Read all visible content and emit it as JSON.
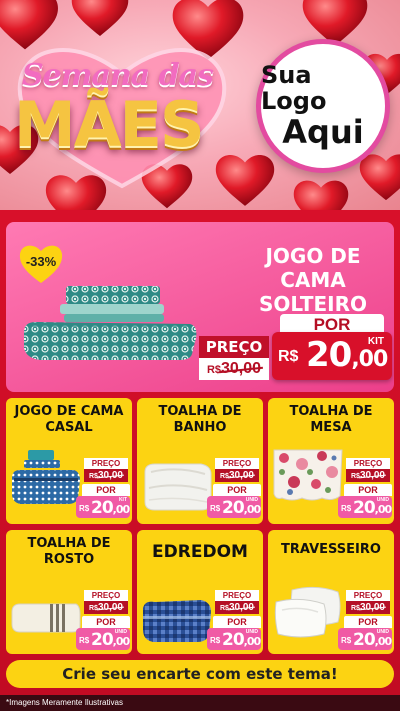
{
  "header": {
    "logo_script": "Semana das",
    "logo_big": "MÃES",
    "brand_line1": "Sua Logo",
    "brand_line2": "Aqui"
  },
  "featured": {
    "discount": "-33%",
    "title": "JOGO DE CAMA SOLTEIRO",
    "preco_label": "PREÇO",
    "old_currency": "R$",
    "old_value": "30,00",
    "por_label": "POR",
    "kit_label": "KIT",
    "currency": "R$",
    "price_int": "20",
    "price_cents": ",00"
  },
  "cards": [
    {
      "title": "JOGO DE CAMA CASAL",
      "preco_label": "PREÇO",
      "old_currency": "R$",
      "old_value": "30,00",
      "por_label": "POR",
      "unit": "KIT",
      "currency": "R$",
      "price_int": "20",
      "price_cents": ",00"
    },
    {
      "title": "TOALHA DE BANHO",
      "preco_label": "PREÇO",
      "old_currency": "R$",
      "old_value": "30,00",
      "por_label": "POR",
      "unit": "UNID",
      "currency": "R$",
      "price_int": "20",
      "price_cents": ",00"
    },
    {
      "title": "TOALHA DE MESA",
      "preco_label": "PREÇO",
      "old_currency": "R$",
      "old_value": "30,00",
      "por_label": "POR",
      "unit": "UNID",
      "currency": "R$",
      "price_int": "20",
      "price_cents": ",00"
    },
    {
      "title": "TOALHA DE ROSTO",
      "preco_label": "PREÇO",
      "old_currency": "R$",
      "old_value": "30,00",
      "por_label": "POR",
      "unit": "UNID",
      "currency": "R$",
      "price_int": "20",
      "price_cents": ",00"
    },
    {
      "title": "EDREDOM",
      "preco_label": "PREÇO",
      "old_currency": "R$",
      "old_value": "30,00",
      "por_label": "POR",
      "unit": "UNID",
      "currency": "R$",
      "price_int": "20",
      "price_cents": ",00"
    },
    {
      "title": "TRAVESSEIRO",
      "preco_label": "PREÇO",
      "old_currency": "R$",
      "old_value": "30,00",
      "por_label": "POR",
      "unit": "UNID",
      "currency": "R$",
      "price_int": "20",
      "price_cents": ",00"
    }
  ],
  "cta": "Crie seu encarte com este tema!",
  "footnote": "*Imagens Meramente Ilustrativas",
  "colors": {
    "main_red": "#d8102a",
    "card_yellow": "#fcd312",
    "featured_pink": "#ec3f8a",
    "price_pink": "#f05aa5",
    "logo_gold": "#f5c441",
    "logo_pink": "#f26cc0"
  }
}
